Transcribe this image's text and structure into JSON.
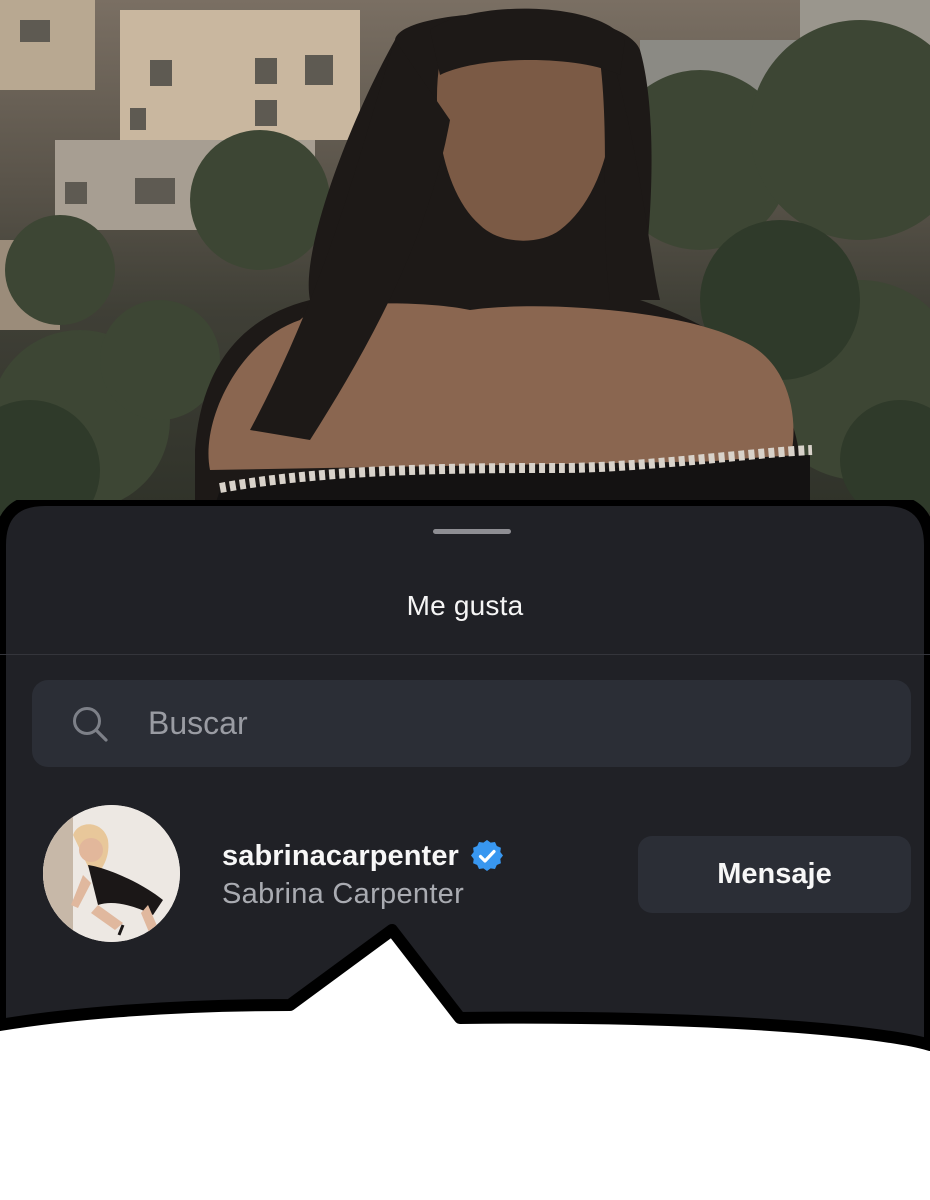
{
  "sheet": {
    "title": "Me gusta"
  },
  "search": {
    "placeholder": "Buscar",
    "icon": "search-icon"
  },
  "likes_list": [
    {
      "username": "sabrinacarpenter",
      "full_name": "Sabrina Carpenter",
      "verified": true,
      "action_label": "Mensaje"
    }
  ],
  "colors": {
    "sheet_background": "#202126",
    "search_background": "#2b2e36",
    "verified_badge": "#3897f0",
    "title_text": "#f5f5f5",
    "secondary_text": "#a9abb1"
  }
}
